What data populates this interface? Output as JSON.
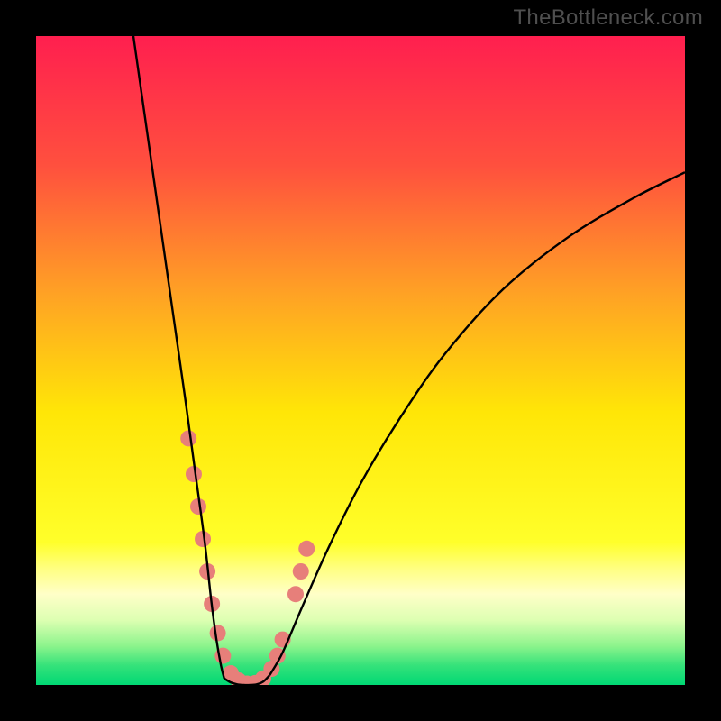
{
  "watermark": "TheBottleneck.com",
  "chart_data": {
    "type": "line",
    "title": "",
    "xlabel": "",
    "ylabel": "",
    "xlim": [
      0,
      100
    ],
    "ylim": [
      0,
      100
    ],
    "grid": false,
    "legend": false,
    "gradient_stops": [
      {
        "pos": 0.0,
        "color": "#ff1f4f"
      },
      {
        "pos": 0.2,
        "color": "#ff503e"
      },
      {
        "pos": 0.4,
        "color": "#ffa324"
      },
      {
        "pos": 0.58,
        "color": "#ffe607"
      },
      {
        "pos": 0.78,
        "color": "#ffff2a"
      },
      {
        "pos": 0.82,
        "color": "#ffff80"
      },
      {
        "pos": 0.86,
        "color": "#ffffc8"
      },
      {
        "pos": 0.9,
        "color": "#ddffb2"
      },
      {
        "pos": 0.94,
        "color": "#8cf48c"
      },
      {
        "pos": 0.97,
        "color": "#35e27a"
      },
      {
        "pos": 1.0,
        "color": "#00d874"
      }
    ],
    "series": [
      {
        "name": "left-curve",
        "x": [
          15,
          17,
          19,
          21,
          23,
          24.5,
          26,
          27,
          27.8,
          28.5,
          29
        ],
        "y": [
          100,
          86,
          72,
          58,
          44,
          33,
          22,
          13,
          7,
          3,
          1
        ]
      },
      {
        "name": "valley-floor",
        "x": [
          29,
          30,
          31,
          32,
          33,
          34,
          35,
          36
        ],
        "y": [
          1,
          0.4,
          0.1,
          0,
          0,
          0.1,
          0.5,
          1.5
        ]
      },
      {
        "name": "right-curve",
        "x": [
          36,
          38,
          41,
          45,
          50,
          56,
          63,
          72,
          82,
          92,
          100
        ],
        "y": [
          1.5,
          5,
          12,
          21,
          31,
          41,
          51,
          61,
          69,
          75,
          79
        ]
      }
    ],
    "scatter": {
      "name": "points",
      "color": "#e77f7a",
      "radius_px": 9,
      "x": [
        23.5,
        24.3,
        25.0,
        25.7,
        26.4,
        27.1,
        28.0,
        28.8,
        30.0,
        31.2,
        32.5,
        33.8,
        35.0,
        36.3,
        37.2,
        38.0,
        40.0,
        40.8,
        41.7
      ],
      "y": [
        38.0,
        32.5,
        27.5,
        22.5,
        17.5,
        12.5,
        8.0,
        4.5,
        1.8,
        0.7,
        0.2,
        0.3,
        1.0,
        2.5,
        4.5,
        7.0,
        14.0,
        17.5,
        21.0
      ]
    }
  }
}
